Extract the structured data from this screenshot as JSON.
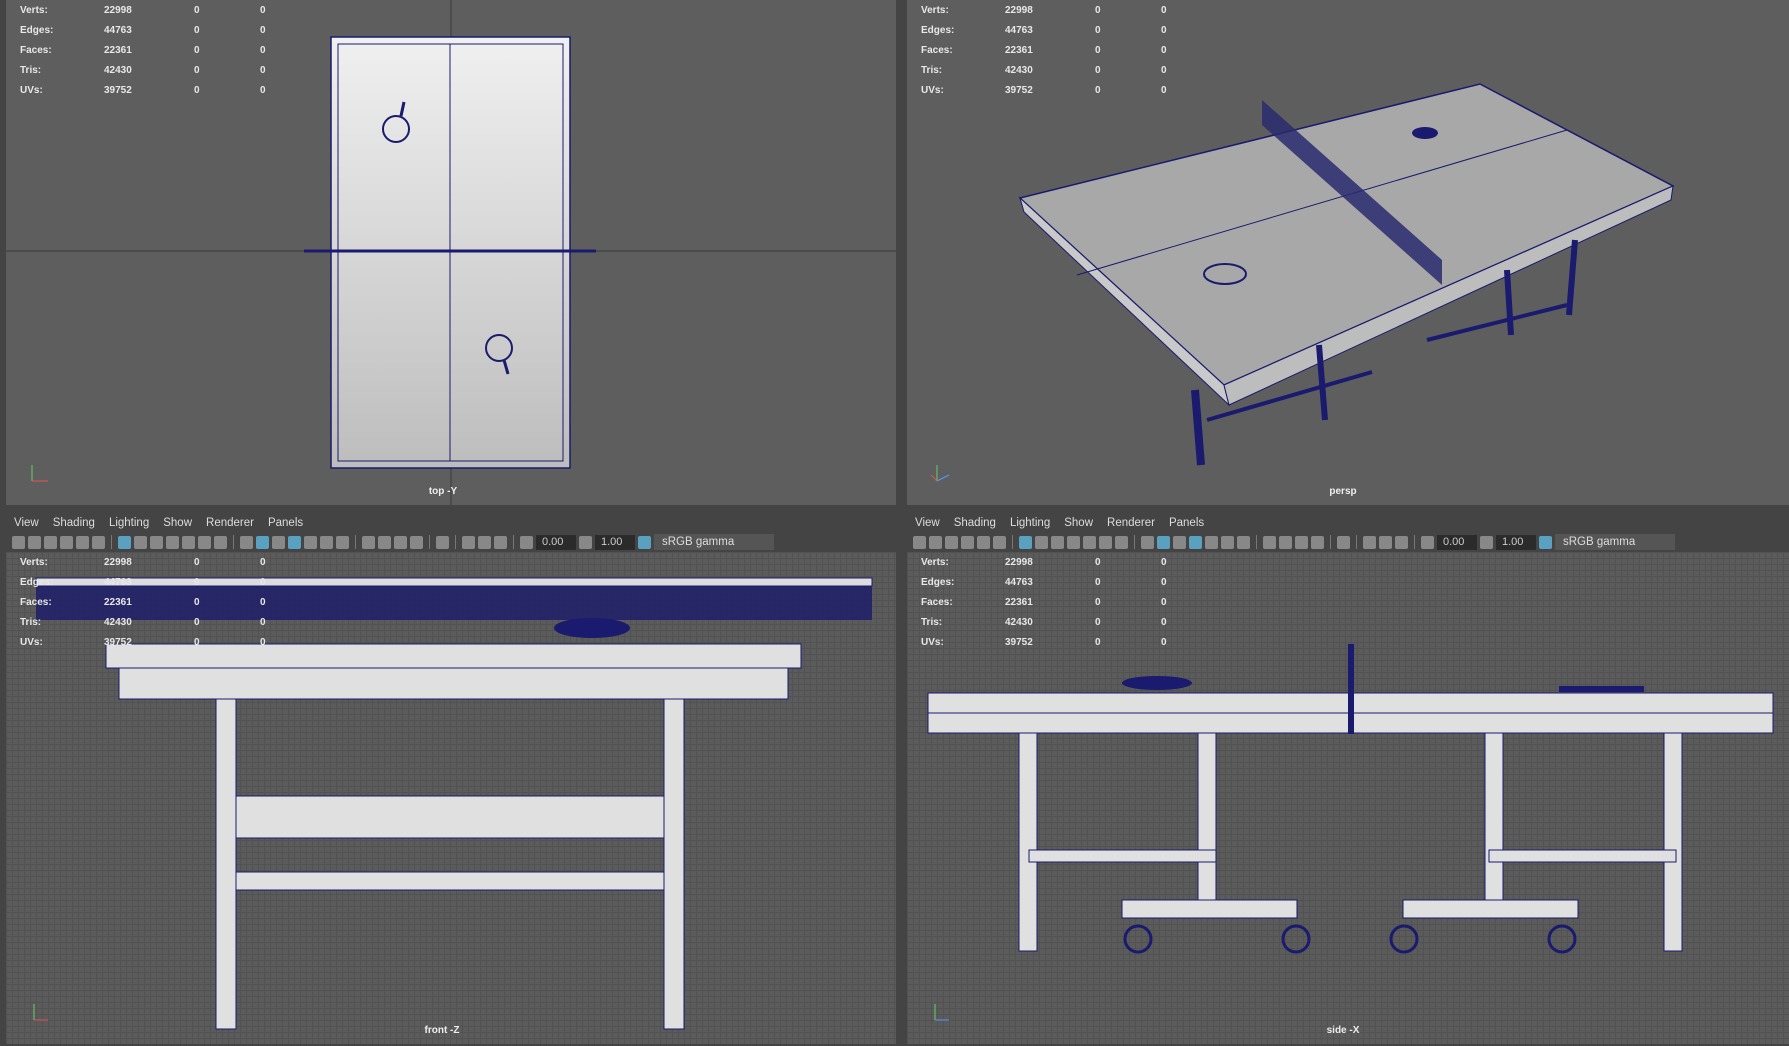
{
  "menu": [
    "View",
    "Shading",
    "Lighting",
    "Show",
    "Renderer",
    "Panels"
  ],
  "stats": [
    {
      "label": "Verts:",
      "value": "22998",
      "a": "0",
      "b": "0"
    },
    {
      "label": "Edges:",
      "value": "44763",
      "a": "0",
      "b": "0"
    },
    {
      "label": "Faces:",
      "value": "22361",
      "a": "0",
      "b": "0"
    },
    {
      "label": "Tris:",
      "value": "42430",
      "a": "0",
      "b": "0"
    },
    {
      "label": "UVs:",
      "value": "39752",
      "a": "0",
      "b": "0"
    }
  ],
  "toolbar": {
    "exposure": "0.00",
    "gamma": "1.00",
    "colorspace": "sRGB gamma"
  },
  "viewports": {
    "top": "top -Y",
    "persp": "persp",
    "front": "front -Z",
    "side": "side -X"
  },
  "colors": {
    "wire": "#1a1a6e",
    "surface": "#d8d8d8",
    "active": "#5aa0c0"
  }
}
